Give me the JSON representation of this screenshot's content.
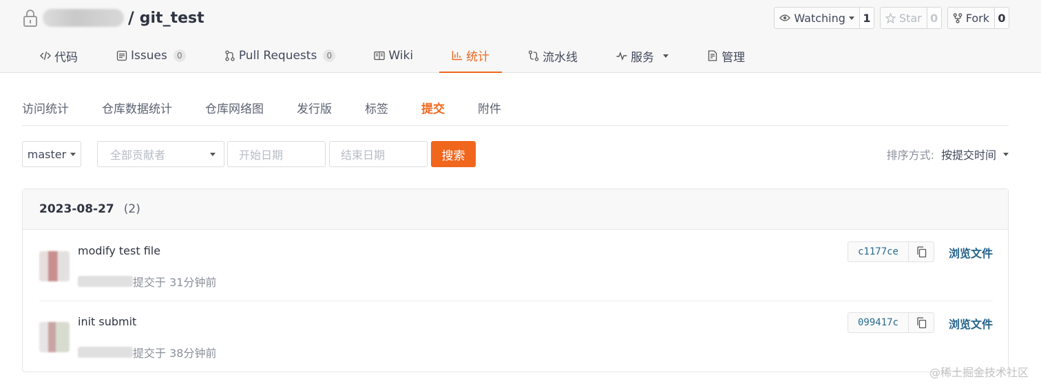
{
  "repo": {
    "separator": "/",
    "name": "git_test"
  },
  "actions": {
    "watching": {
      "label": "Watching",
      "count": "1"
    },
    "star": {
      "label": "Star",
      "count": "0"
    },
    "fork": {
      "label": "Fork",
      "count": "0"
    }
  },
  "tabs": [
    {
      "label": "代码",
      "icon": "code-icon"
    },
    {
      "label": "Issues",
      "badge": "0",
      "icon": "issues-icon"
    },
    {
      "label": "Pull Requests",
      "badge": "0",
      "icon": "pull-request-icon"
    },
    {
      "label": "Wiki",
      "icon": "book-icon"
    },
    {
      "label": "统计",
      "icon": "bar-chart-icon",
      "active": true
    },
    {
      "label": "流水线",
      "icon": "pipeline-icon"
    },
    {
      "label": "服务",
      "icon": "pulse-icon"
    },
    {
      "label": "管理",
      "icon": "settings-doc-icon"
    }
  ],
  "subtabs": [
    "访问统计",
    "仓库数据统计",
    "仓库网络图",
    "发行版",
    "标签",
    "提交",
    "附件"
  ],
  "filters": {
    "branch": "master",
    "author_placeholder": "全部贡献者",
    "start_placeholder": "开始日期",
    "end_placeholder": "结束日期",
    "search_label": "搜索",
    "sort_label": "排序方式:",
    "sort_value": "按提交时间"
  },
  "commit_group": {
    "date": "2023-08-27",
    "count": "(2)",
    "commits": [
      {
        "message": "modify test file",
        "time": "提交于 31分钟前",
        "sha": "c1177ce",
        "browse": "浏览文件"
      },
      {
        "message": "init submit",
        "time": "提交于 38分钟前",
        "sha": "099417c",
        "browse": "浏览文件"
      }
    ]
  },
  "watermark": "@稀土掘金技术社区",
  "colors": {
    "accent": "#f0661d",
    "link": "#24628a",
    "sha": "#276a8e"
  }
}
